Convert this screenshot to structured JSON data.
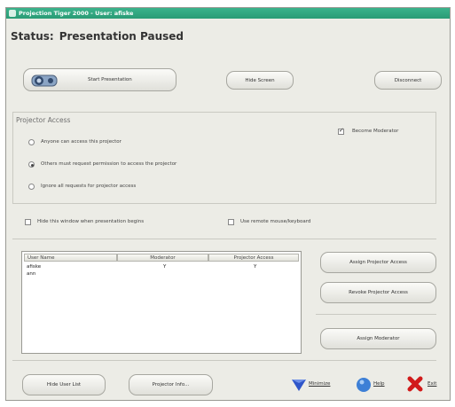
{
  "window": {
    "title": "Projection Tiger 2000 - User: afiske"
  },
  "status": {
    "label": "Status:",
    "value": "Presentation Paused"
  },
  "top_buttons": {
    "start_presentation": "Start Presentation",
    "hide_screen": "Hide Screen",
    "disconnect": "Disconnect"
  },
  "projector_access": {
    "group_label": "Projector Access",
    "options": [
      {
        "label": "Anyone can access this projector",
        "selected": false
      },
      {
        "label": "Others must request permission to access the projector",
        "selected": true
      },
      {
        "label": "Ignore all requests for projector access",
        "selected": false
      }
    ],
    "become_moderator": {
      "label": "Become Moderator",
      "checked": true
    }
  },
  "options": {
    "hide_window": {
      "label": "Hide this window when presentation begins",
      "checked": false
    },
    "remote_input": {
      "label": "Use remote mouse/keyboard",
      "checked": false
    }
  },
  "user_table": {
    "columns": [
      "User Name",
      "Moderator",
      "Projector Access"
    ],
    "rows": [
      {
        "name": "afiske",
        "moderator": "Y",
        "access": "Y"
      },
      {
        "name": "ann",
        "moderator": "",
        "access": ""
      }
    ]
  },
  "side_buttons": {
    "assign_access": "Assign Projector Access",
    "revoke_access": "Revoke Projector Access",
    "assign_moderator": "Assign Moderator"
  },
  "footer": {
    "hide_user_list": "Hide User List",
    "projector_info": "Projector Info...",
    "minimize": "Minimize",
    "help": "Help",
    "exit": "Exit"
  },
  "colors": {
    "title_bar": "#2a9b75",
    "minimize_icon": "#2f56c9",
    "help_icon": "#3d7fd6",
    "exit_icon": "#d11a1a"
  }
}
